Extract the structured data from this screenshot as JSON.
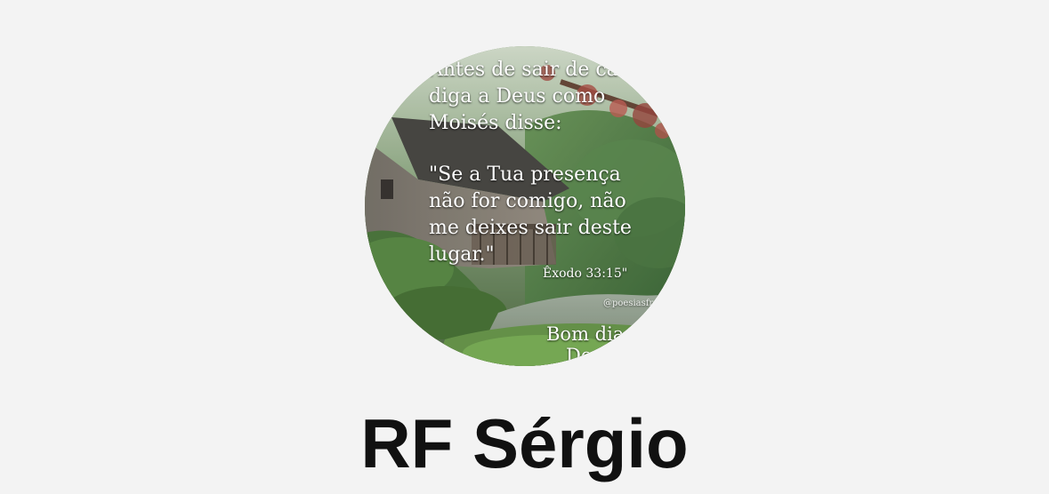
{
  "profile": {
    "name": "RF Sérgio",
    "avatar": {
      "alt": "profile-photo",
      "quote_lines": [
        "Antes de sair de casa",
        "diga a Deus como",
        "Moisés disse:",
        "\"Se a Tua presença",
        "não for comigo, não",
        "me deixes sair deste",
        "lugar.\""
      ],
      "reference": "Êxodo 33:15\"",
      "handle": "@poesiasfrases",
      "footer_lines": [
        "Bom dia",
        "Deus"
      ]
    }
  },
  "colors": {
    "background": "#f3f3f3",
    "name_text": "#111111"
  }
}
